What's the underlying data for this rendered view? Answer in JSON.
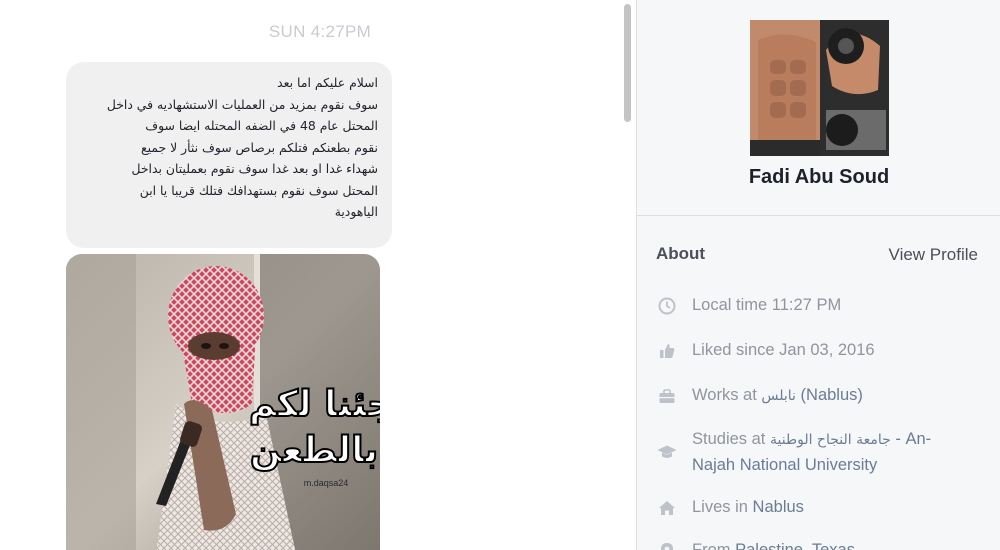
{
  "chat": {
    "timestamp": "SUN 4:27PM",
    "message_lines": [
      "اسلام عليكم اما بعد",
      "سوف نقوم بمزيد من العمليات الاستشهاديه في داخل",
      "المحتل عام 48 في الضفه المحتله ايضا سوف",
      "نقوم بطعنكم فتلكم برصاص سوف نثأر لا جميع",
      "شهداء غدا او بعد غدا سوف نقوم بعمليتان بداخل",
      "المحتل سوف نقوم بستهدافك فتلك قريبا يا ابن",
      "الياهودية"
    ],
    "image": {
      "overlay_text_line1": "جئنا لكم",
      "overlay_text_line2": "بالطعن",
      "watermark": "m.daqsa24"
    }
  },
  "profile": {
    "name": "Fadi Abu Soud",
    "about_title": "About",
    "view_profile_label": "View Profile",
    "local_time": {
      "label": "Local time",
      "value": "11:27 PM",
      "icon": "clock-icon"
    },
    "liked": {
      "label": "Liked since",
      "value": "Jan 03, 2016",
      "icon": "thumbs-up-icon"
    },
    "works": {
      "label": "Works at",
      "place": "نابلس",
      "city": "(Nablus)",
      "icon": "briefcase-icon"
    },
    "studies": {
      "label": "Studies at",
      "place_ar": "جامعة النجاح الوطنية",
      "place_en_1": "- An-",
      "place_en_2": "Najah National University",
      "icon": "graduation-cap-icon"
    },
    "lives": {
      "label": "Lives in",
      "value": "Nablus",
      "icon": "home-icon"
    },
    "from": {
      "label": "From",
      "value": "Palestine, Texas",
      "icon": "location-pin-icon"
    }
  },
  "colors": {
    "bubble_bg": "#f1f0f0",
    "panel_bg": "#f6f7f9",
    "muted_text": "#90949c",
    "link_text": "#6b7c94"
  }
}
